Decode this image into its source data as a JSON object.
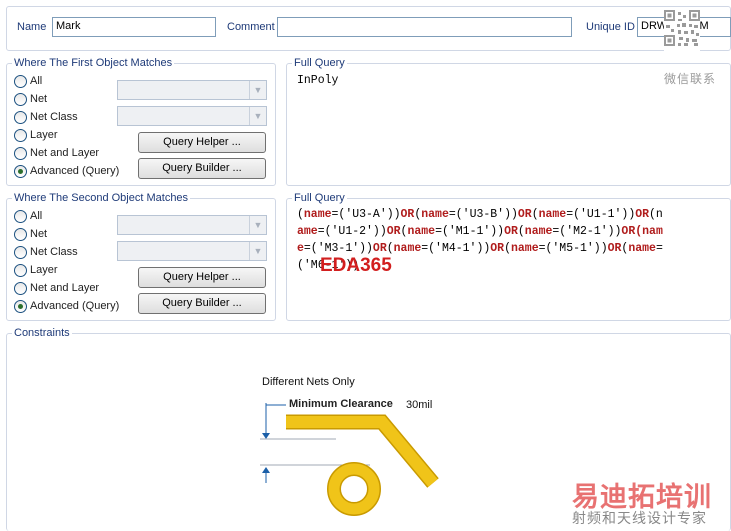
{
  "header": {
    "name_label": "Name",
    "name_value": "Mark",
    "comment_label": "Comment",
    "comment_value": "",
    "uid_label": "Unique ID",
    "uid_value": "DRWXHDMM"
  },
  "first_group": {
    "title": "Where The First Object Matches",
    "options": [
      "All",
      "Net",
      "Net Class",
      "Layer",
      "Net and Layer",
      "Advanced (Query)"
    ],
    "selected": "Advanced (Query)",
    "query_helper_label": "Query Helper ...",
    "query_builder_label": "Query Builder ...",
    "full_query_title": "Full Query",
    "full_query": "InPoly"
  },
  "second_group": {
    "title": "Where The Second Object Matches",
    "options": [
      "All",
      "Net",
      "Net Class",
      "Layer",
      "Net and Layer",
      "Advanced (Query)"
    ],
    "selected": "Advanced (Query)",
    "query_helper_label": "Query Helper ...",
    "query_builder_label": "Query Builder ...",
    "full_query_title": "Full Query",
    "full_query_lines": [
      [
        [
          "(",
          "t"
        ],
        [
          "name",
          "k"
        ],
        [
          "=('U3-A'))",
          "t"
        ],
        [
          "OR",
          "k"
        ],
        [
          "(",
          "t"
        ],
        [
          "name",
          "k"
        ],
        [
          "=('U3-B'))",
          "t"
        ],
        [
          "OR",
          "k"
        ],
        [
          "(",
          "t"
        ],
        [
          "name",
          "k"
        ],
        [
          "=('U1-1'))",
          "t"
        ],
        [
          "OR",
          "k"
        ],
        [
          "(n",
          "t"
        ]
      ],
      [
        [
          "ame",
          "k"
        ],
        [
          "=('U1-2'))",
          "t"
        ],
        [
          "OR",
          "k"
        ],
        [
          "(",
          "t"
        ],
        [
          "name",
          "k"
        ],
        [
          "=('M1-1'))",
          "t"
        ],
        [
          "OR",
          "k"
        ],
        [
          "(",
          "t"
        ],
        [
          "name",
          "k"
        ],
        [
          "=('M2-1'))",
          "t"
        ],
        [
          "OR",
          "k"
        ],
        [
          "(nam",
          "k"
        ]
      ],
      [
        [
          "e",
          "k"
        ],
        [
          "=('M3-1'))",
          "t"
        ],
        [
          "OR",
          "k"
        ],
        [
          "(",
          "t"
        ],
        [
          "name",
          "k"
        ],
        [
          "=('M4-1'))",
          "t"
        ],
        [
          "OR",
          "k"
        ],
        [
          "(",
          "t"
        ],
        [
          "name",
          "k"
        ],
        [
          "=('M5-1'))",
          "t"
        ],
        [
          "OR",
          "k"
        ],
        [
          "(",
          "t"
        ],
        [
          "name",
          "k"
        ],
        [
          "=",
          "t"
        ]
      ],
      [
        [
          "('M6-1'))",
          "t"
        ]
      ]
    ]
  },
  "watermarks": {
    "eda": "EDA365",
    "wechat": "微信联系",
    "brand": "易迪拓培训",
    "brand_sub": "射频和天线设计专家"
  },
  "constraints": {
    "title": "Constraints",
    "nets_label": "Different Nets Only",
    "min_clearance_label": "Minimum Clearance",
    "min_clearance_value": "30mil",
    "colors": {
      "trace": "#f0c419",
      "trace_outline": "#c99a00",
      "dim": "#1b5fa8"
    }
  }
}
